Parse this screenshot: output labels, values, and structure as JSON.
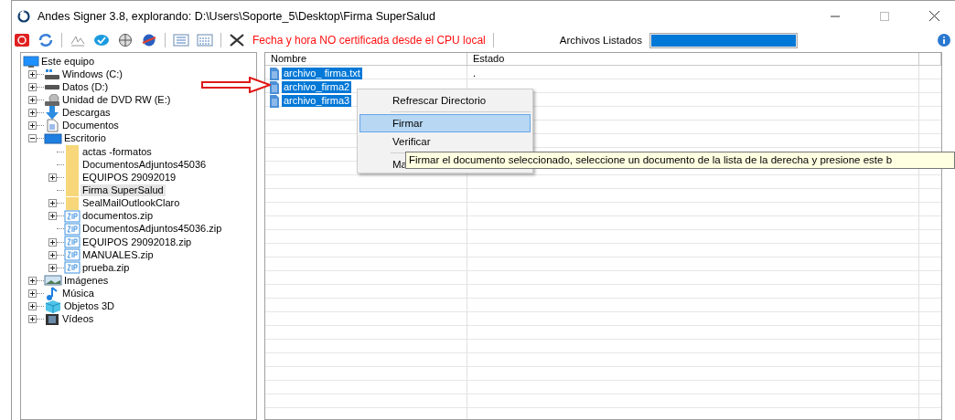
{
  "window": {
    "title": "Andes Signer 3.8, explorando: D:\\Users\\Soporte_5\\Desktop\\Firma SuperSalud"
  },
  "toolbar": {
    "warning": "Fecha y hora NO certificada desde el CPU local",
    "progress_label": "Archivos Listados",
    "progress": {
      "level": 1
    }
  },
  "tree": {
    "label": "Este equipo",
    "kind": "computer",
    "selected": false,
    "children": [
      {
        "label": "Windows (C:)",
        "kind": "windrive",
        "expanded": false,
        "selected": false
      },
      {
        "label": "Datos (D:)",
        "kind": "drive",
        "expanded": false,
        "selected": false
      },
      {
        "label": "Unidad de DVD RW (E:)",
        "kind": "dvd",
        "expanded": false,
        "selected": false
      },
      {
        "label": "Descargas",
        "kind": "download",
        "expanded": false,
        "selected": false
      },
      {
        "label": "Documentos",
        "kind": "document",
        "expanded": false,
        "selected": false
      },
      {
        "label": "Escritorio",
        "kind": "desktop",
        "expanded": true,
        "selected": false,
        "children": [
          {
            "label": "actas -formatos",
            "kind": "folder",
            "selected": false
          },
          {
            "label": "DocumentosAdjuntos45036",
            "kind": "folder",
            "selected": false
          },
          {
            "label": "EQUIPOS 29092019",
            "kind": "folder",
            "expanded": false,
            "selected": false
          },
          {
            "label": "Firma SuperSalud",
            "kind": "folder",
            "selected": true
          },
          {
            "label": "SealMailOutlookClaro",
            "kind": "folder",
            "expanded": false,
            "selected": false
          },
          {
            "label": "documentos.zip",
            "kind": "zip",
            "expanded": false,
            "selected": false
          },
          {
            "label": "DocumentosAdjuntos45036.zip",
            "kind": "zip",
            "selected": false
          },
          {
            "label": "EQUIPOS 29092018.zip",
            "kind": "zip",
            "expanded": false,
            "selected": false
          },
          {
            "label": "MANUALES.zip",
            "kind": "zip",
            "expanded": false,
            "selected": false
          },
          {
            "label": "prueba.zip",
            "kind": "zip",
            "expanded": false,
            "selected": false
          }
        ]
      },
      {
        "label": "Imágenes",
        "kind": "images",
        "expanded": false,
        "selected": false
      },
      {
        "label": "Música",
        "kind": "music",
        "expanded": false,
        "selected": false
      },
      {
        "label": "Objetos 3D",
        "kind": "cube",
        "expanded": false,
        "selected": false
      },
      {
        "label": "Vídeos",
        "kind": "video",
        "expanded": false,
        "selected": false
      }
    ]
  },
  "files": {
    "columns": [
      "Nombre",
      "Estado"
    ],
    "rows": [
      {
        "name": "archivo_ firma.txt",
        "status": ".",
        "selected": true
      },
      {
        "name": "archivo_firma2",
        "selected": true
      },
      {
        "name": "archivo_firma3",
        "selected": true
      }
    ]
  },
  "context_menu": {
    "items": [
      {
        "kind": "item",
        "label": "Refrescar Directorio",
        "selected": false
      },
      {
        "kind": "separator"
      },
      {
        "kind": "item",
        "label": "Firmar",
        "selected": true
      },
      {
        "kind": "item",
        "label": "Verificar",
        "selected": false
      },
      {
        "kind": "separator"
      },
      {
        "kind": "item",
        "label": "Ma",
        "selected": false
      }
    ]
  },
  "tooltip": "Firmar el documento seleccionado, seleccione un documento de la lista de la derecha y presione este b"
}
